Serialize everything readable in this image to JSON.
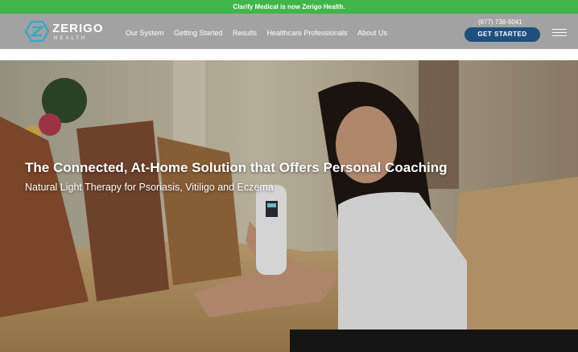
{
  "announcement": {
    "text": "Clarify Medical is now Zerigo Health."
  },
  "header": {
    "logo_word": "ZERIGO",
    "logo_sub": "HEALTH",
    "nav": [
      "Our System",
      "Getting Started",
      "Results",
      "Healthcare Professionals",
      "About Us"
    ],
    "phone": "(877) 738-6041",
    "cta_label": "GET STARTED"
  },
  "hero": {
    "title": "The Connected, At-Home Solution that Offers Personal Coaching",
    "subtitle": "Natural Light Therapy for Psoriasis, Vitiligo and Eczema"
  },
  "colors": {
    "announcement_bg": "#3fb54a",
    "nav_bg": "#a2a2a2",
    "cta_bg": "#1f4f7e",
    "logo_accent": "#3aa6c8"
  },
  "icons": {
    "logo": "zerigo-logo-icon",
    "menu": "hamburger-menu-icon"
  }
}
